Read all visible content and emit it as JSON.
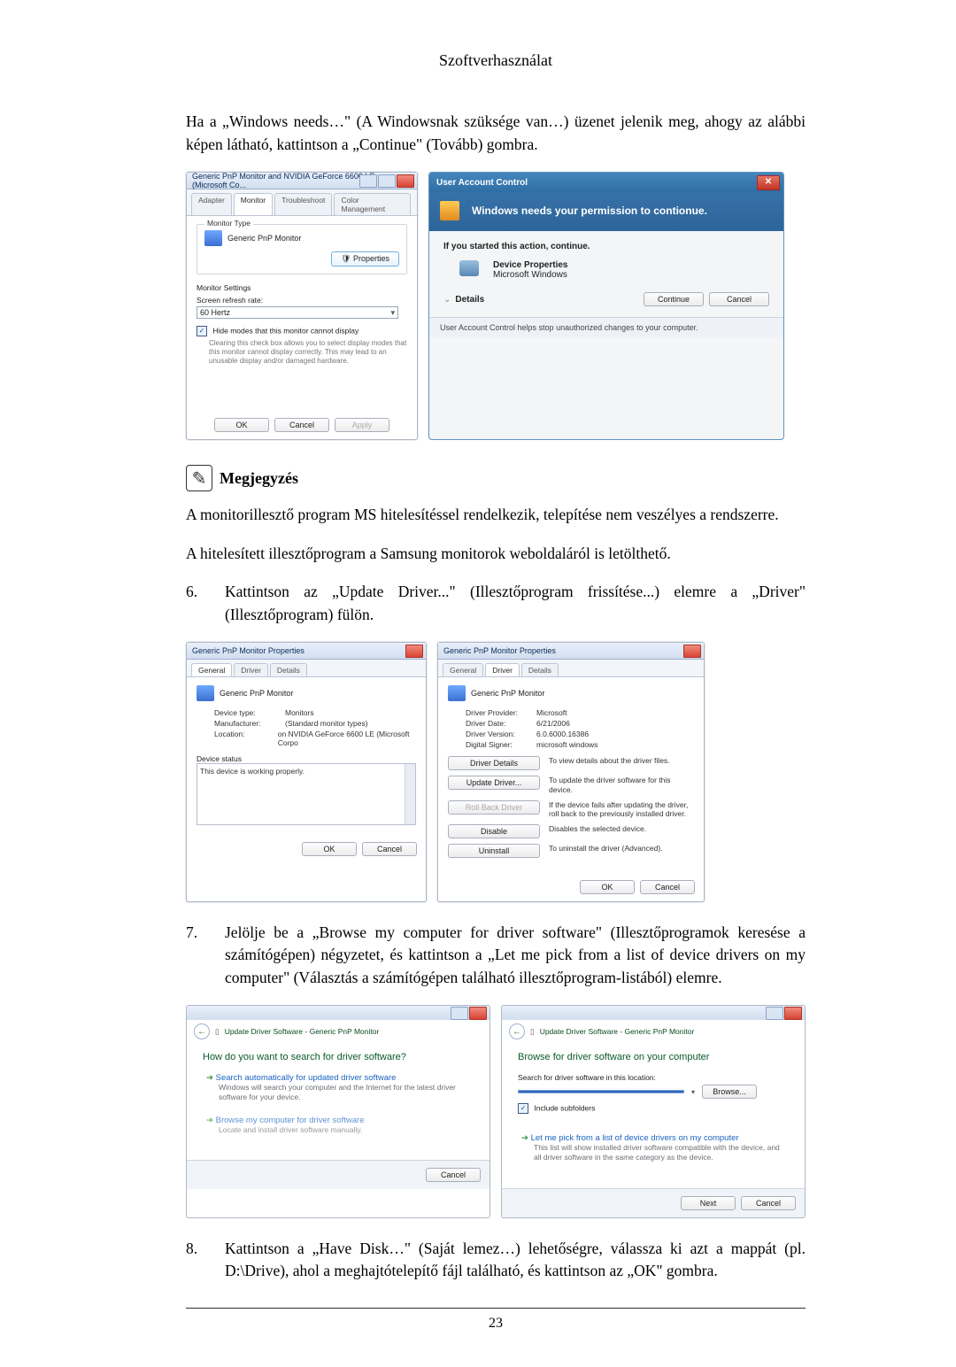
{
  "doc": {
    "title": "Szoftverhasználat",
    "page_number": "23"
  },
  "para_windows_needs": "Ha a „Windows needs…\" (A Windowsnak szüksége van…) üzenet jelenik meg, ahogy az alábbi képen látható, kattintson a „Continue\" (Tovább) gombra.",
  "note": {
    "label": "Megjegyzés",
    "line1": "A monitorillesztő program MS hitelesítéssel rendelkezik, telepítése nem veszélyes a rendszerre.",
    "line2": "A hitelesített illesztőprogram a Samsung monitorok weboldaláról is letölthető."
  },
  "step6": {
    "num": "6.",
    "text": "Kattintson az „Update Driver...\" (Illesztőprogram frissítése...) elemre a „Driver\" (Illesztőprogram) fülön."
  },
  "step7": {
    "num": "7.",
    "text": "Jelölje be a „Browse my computer for driver software\" (Illesztőprogramok keresése a számítógépen) négyzetet, és kattintson a „Let me pick from a list of device drivers on my computer\" (Választás a számítógépen található illesztőprogram-listából) elemre."
  },
  "step8": {
    "num": "8.",
    "text": "Kattintson a „Have Disk…\" (Saját lemez…) lehetőségre, válassza ki azt a mappát (pl. D:\\Drive), ahol a meghajtótelepítő fájl található, és kattintson az „OK\" gombra."
  },
  "monitor_props": {
    "title": "Generic PnP Monitor and NVIDIA GeForce 6600 LE (Microsoft Co...",
    "tabs": [
      "Adapter",
      "Monitor",
      "Troubleshoot",
      "Color Management"
    ],
    "monitor_type_legend": "Monitor Type",
    "monitor_name": "Generic PnP Monitor",
    "btn_properties": "Properties",
    "monitor_settings_legend": "Monitor Settings",
    "refresh_label": "Screen refresh rate:",
    "refresh_value": "60 Hertz",
    "hide_modes_check": "Hide modes that this monitor cannot display",
    "hide_modes_note": "Clearing this check box allows you to select display modes that this monitor cannot display correctly. This may lead to an unusable display and/or damaged hardware.",
    "btn_ok": "OK",
    "btn_cancel": "Cancel",
    "btn_apply": "Apply"
  },
  "uac": {
    "title": "User Account Control",
    "headline": "Windows needs your permission to contionue.",
    "started": "If you started this action, continue.",
    "prog1": "Device Properties",
    "prog2": "Microsoft Windows",
    "details": "Details",
    "btn_continue": "Continue",
    "btn_cancel": "Cancel",
    "footer": "User Account Control helps stop unauthorized changes to your computer."
  },
  "dev_props_general": {
    "title": "Generic PnP Monitor Properties",
    "tabs": [
      "General",
      "Driver",
      "Details"
    ],
    "name": "Generic PnP Monitor",
    "kv": {
      "device_type_k": "Device type:",
      "device_type_v": "Monitors",
      "manufacturer_k": "Manufacturer:",
      "manufacturer_v": "(Standard monitor types)",
      "location_k": "Location:",
      "location_v": "on NVIDIA GeForce 6600 LE (Microsoft Corpo"
    },
    "status_legend": "Device status",
    "status_text": "This device is working properly.",
    "btn_ok": "OK",
    "btn_cancel": "Cancel"
  },
  "dev_props_driver": {
    "title": "Generic PnP Monitor Properties",
    "tabs": [
      "General",
      "Driver",
      "Details"
    ],
    "name": "Generic PnP Monitor",
    "kv": {
      "provider_k": "Driver Provider:",
      "provider_v": "Microsoft",
      "date_k": "Driver Date:",
      "date_v": "6/21/2006",
      "version_k": "Driver Version:",
      "version_v": "6.0.6000.16386",
      "signer_k": "Digital Signer:",
      "signer_v": "microsoft windows"
    },
    "rows": {
      "details_btn": "Driver Details",
      "details_txt": "To view details about the driver files.",
      "update_btn": "Update Driver...",
      "update_txt": "To update the driver software for this device.",
      "rollback_btn": "Roll Back Driver",
      "rollback_txt": "If the device fails after updating the driver, roll back to the previously installed driver.",
      "disable_btn": "Disable",
      "disable_txt": "Disables the selected device.",
      "uninstall_btn": "Uninstall",
      "uninstall_txt": "To uninstall the driver (Advanced)."
    },
    "btn_ok": "OK",
    "btn_cancel": "Cancel"
  },
  "wizard_search": {
    "bread": "Update Driver Software - Generic PnP Monitor",
    "heading": "How do you want to search for driver software?",
    "opt1_title": "Search automatically for updated driver software",
    "opt1_sub": "Windows will search your computer and the Internet for the latest driver software for your device.",
    "opt2_title": "Browse my computer for driver software",
    "opt2_sub": "Locate and install driver software manually.",
    "btn_cancel": "Cancel"
  },
  "wizard_browse": {
    "bread": "Update Driver Software - Generic PnP Monitor",
    "heading": "Browse for driver software on your computer",
    "loc_label": "Search for driver software in this location:",
    "path": "",
    "btn_browse": "Browse...",
    "include_sub": "Include subfolders",
    "opt_title": "Let me pick from a list of device drivers on my computer",
    "opt_sub": "This list will show installed driver software compatible with the device, and all driver software in the same category as the device.",
    "btn_next": "Next",
    "btn_cancel": "Cancel"
  }
}
